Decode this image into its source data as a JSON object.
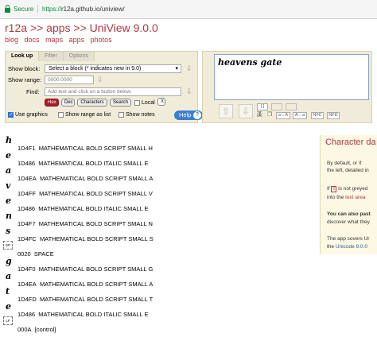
{
  "browser": {
    "secure_label": "Secure",
    "url_scheme": "https://",
    "url_rest": "r12a.github.io/uniview/"
  },
  "site": {
    "title": "r12a >> apps >> UniView 9.0.0",
    "nav": [
      "blog",
      "docs",
      "maps",
      "apps",
      "photos"
    ]
  },
  "tabs": [
    "Look up",
    "Filter",
    "Options"
  ],
  "controls": {
    "show_block_label": "Show block:",
    "show_block_value": "Select a block (* indicates new in 9.0)",
    "show_range_label": "Show range:",
    "show_range_value": "0000:0000",
    "find_label": "Find:",
    "find_placeholder": "Add text and click on a button below.",
    "buttons": [
      "Hex",
      "Dec",
      "Characters",
      "Search"
    ],
    "local_label": "Local",
    "x_label": "X",
    "use_graphics_label": "Use graphics",
    "show_range_list_label": "Show range as list",
    "show_notes_label": "Show notes",
    "help_label": "Help"
  },
  "textarea": {
    "value": "heavens gate",
    "buttons": [
      "[ ]",
      "a→A",
      "A→a",
      "NFC",
      "NFD"
    ]
  },
  "characters": [
    {
      "glyph": "h",
      "code": "1D4F1",
      "name": "MATHEMATICAL BOLD SCRIPT SMALL H"
    },
    {
      "glyph": "e",
      "code": "1D486",
      "name": "MATHEMATICAL BOLD ITALIC SMALL E"
    },
    {
      "glyph": "a",
      "code": "1D4EA",
      "name": "MATHEMATICAL BOLD SCRIPT SMALL A"
    },
    {
      "glyph": "v",
      "code": "1D4FF",
      "name": "MATHEMATICAL BOLD SCRIPT SMALL V"
    },
    {
      "glyph": "e",
      "code": "1D486",
      "name": "MATHEMATICAL BOLD ITALIC SMALL E"
    },
    {
      "glyph": "n",
      "code": "1D4F7",
      "name": "MATHEMATICAL BOLD SCRIPT SMALL N"
    },
    {
      "glyph": "s",
      "code": "1D4FC",
      "name": "MATHEMATICAL BOLD SCRIPT SMALL S"
    },
    {
      "glyph": "SP",
      "code": "0020",
      "name": "SPACE",
      "control": true
    },
    {
      "glyph": "g",
      "code": "1D4F0",
      "name": "MATHEMATICAL BOLD SCRIPT SMALL G"
    },
    {
      "glyph": "a",
      "code": "1D4EA",
      "name": "MATHEMATICAL BOLD SCRIPT SMALL A"
    },
    {
      "glyph": "t",
      "code": "1D4FD",
      "name": "MATHEMATICAL BOLD SCRIPT SMALL T"
    },
    {
      "glyph": "e",
      "code": "1D486",
      "name": "MATHEMATICAL BOLD ITALIC SMALL E"
    },
    {
      "glyph": "LF",
      "code": "000A",
      "name": "[control]",
      "control": true
    }
  ],
  "sidebar": {
    "title": "Character da",
    "lines": [
      "By default, or if",
      "the left, detailed in",
      "If",
      "is not greyed",
      "into the",
      "text area",
      "You can also past",
      "discover what they",
      "The app covers Ur",
      "the",
      "Unicode 9.0.0"
    ]
  },
  "colors": {
    "accent": "#b0383f",
    "panel": "#f1ecd9",
    "secure": "#0a8a3a",
    "help": "#3b7fd0",
    "hex_button": "#b01a25"
  }
}
